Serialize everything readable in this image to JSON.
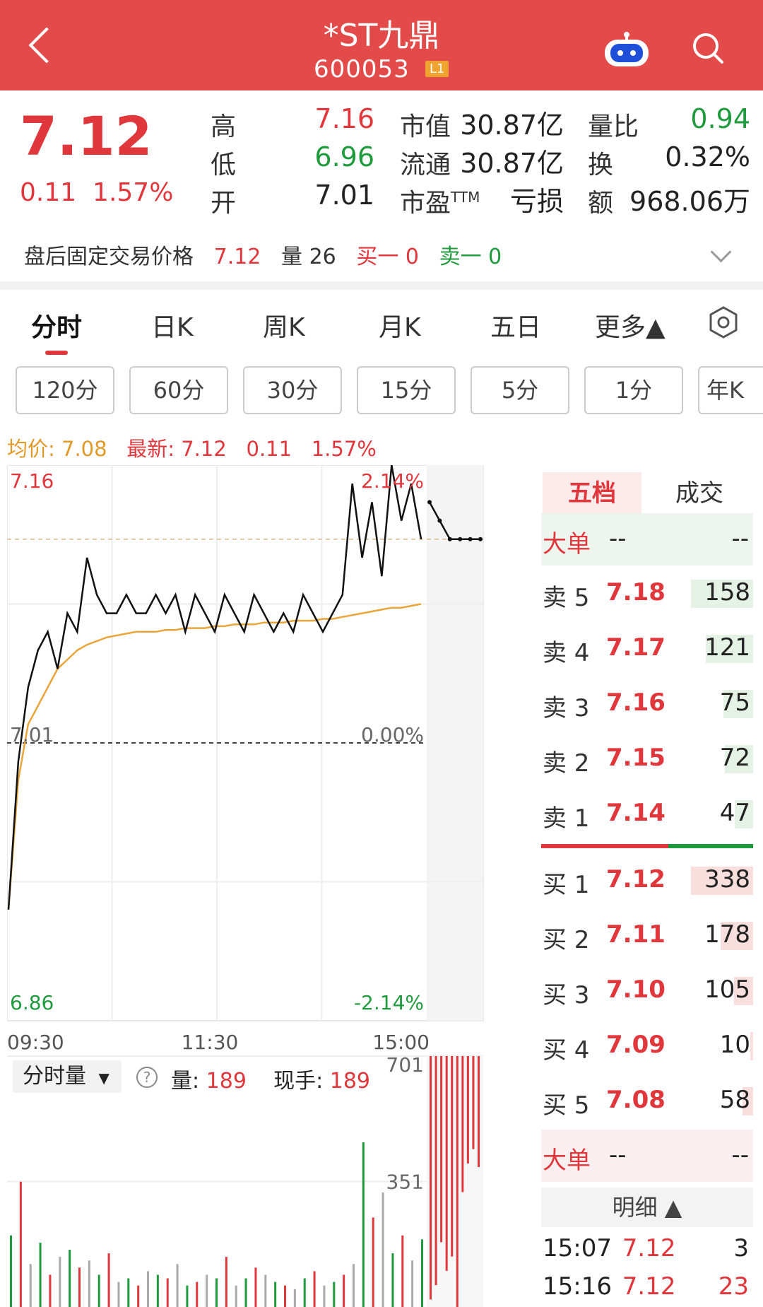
{
  "header": {
    "title": "*ST九鼎",
    "code": "600053",
    "level_badge": "L1",
    "bg_color": "#e34b4b"
  },
  "quote": {
    "price": "7.12",
    "change": "0.11",
    "change_pct": "1.57%",
    "fields": [
      {
        "label": "高",
        "value": "7.16",
        "color": "red"
      },
      {
        "label": "低",
        "value": "6.96",
        "color": "green"
      },
      {
        "label": "开",
        "value": "7.01",
        "color": "black"
      }
    ],
    "fields2": [
      {
        "label": "市值",
        "value": "30.87亿"
      },
      {
        "label": "流通",
        "value": "30.87亿"
      },
      {
        "label": "市盈",
        "sup": "TTM",
        "value": "亏损"
      }
    ],
    "fields3": [
      {
        "label": "量比",
        "value": "0.94",
        "color": "green"
      },
      {
        "label": "换",
        "value": "0.32%",
        "color": "black"
      },
      {
        "label": "额",
        "value": "968.06万",
        "color": "black"
      }
    ]
  },
  "after_hours": {
    "label": "盘后固定交易价格",
    "price": "7.12",
    "vol_label": "量",
    "vol": "26",
    "buy1": "买一 0",
    "sell1": "卖一 0"
  },
  "tabs": [
    "分时",
    "日K",
    "周K",
    "月K",
    "五日",
    "更多▲"
  ],
  "periods": [
    "120分",
    "60分",
    "30分",
    "15分",
    "5分",
    "1分",
    "年K"
  ],
  "info": {
    "avg_label": "均价:",
    "avg": "7.08",
    "last_label": "最新:",
    "last": "7.12",
    "chg": "0.11",
    "pct": "1.57%"
  },
  "chart_labels": {
    "high_price": "7.16",
    "high_pct": "2.14%",
    "mid_price": "7.01",
    "mid_pct": "0.00%",
    "low_price": "6.86",
    "low_pct": "-2.14%",
    "time_start": "09:30",
    "time_mid": "11:30",
    "time_end": "15:00",
    "vol_max": "701",
    "vol_mid": "351"
  },
  "volume_header": {
    "selector": "分时量",
    "vol_label": "量:",
    "vol": "189",
    "hand_label": "现手:",
    "hand": "189"
  },
  "order_book": {
    "tab_active": "五档",
    "tab_other": "成交",
    "big_label": "大单",
    "big_left": "--",
    "big_right": "--",
    "asks": [
      {
        "label": "卖 5",
        "price": "7.18",
        "vol": "158"
      },
      {
        "label": "卖 4",
        "price": "7.17",
        "vol": "121"
      },
      {
        "label": "卖 3",
        "price": "7.16",
        "vol": "75"
      },
      {
        "label": "卖 2",
        "price": "7.15",
        "vol": "72"
      },
      {
        "label": "卖 1",
        "price": "7.14",
        "vol": "47"
      }
    ],
    "bids": [
      {
        "label": "买 1",
        "price": "7.12",
        "vol": "338"
      },
      {
        "label": "买 2",
        "price": "7.11",
        "vol": "178"
      },
      {
        "label": "买 3",
        "price": "7.10",
        "vol": "105"
      },
      {
        "label": "买 4",
        "price": "7.09",
        "vol": "10"
      },
      {
        "label": "买 5",
        "price": "7.08",
        "vol": "58"
      }
    ],
    "detail_label": "明细 ▲",
    "ticks": [
      {
        "time": "15:07",
        "price": "7.12",
        "vol": "3"
      },
      {
        "time": "15:16",
        "price": "7.12",
        "vol": "23"
      }
    ]
  },
  "chart_data": {
    "type": "line",
    "title": "",
    "xlabel": "",
    "ylabel": "",
    "ylim": [
      6.86,
      7.16
    ],
    "x_ticks": [
      "09:30",
      "11:30",
      "15:00"
    ],
    "reference_price": 7.01,
    "series": [
      {
        "values": [
          6.92,
          7.0,
          7.04,
          7.06,
          7.07,
          7.05,
          7.08,
          7.07,
          7.11,
          7.09,
          7.08,
          7.08,
          7.09,
          7.08,
          7.08,
          7.09,
          7.08,
          7.09,
          7.07,
          7.09,
          7.08,
          7.07,
          7.09,
          7.08,
          7.07,
          7.09,
          7.08,
          7.07,
          7.08,
          7.07,
          7.09,
          7.08,
          7.07,
          7.08,
          7.09,
          7.15,
          7.11,
          7.14,
          7.1,
          7.16,
          7.13,
          7.15,
          7.12
        ]
      },
      {
        "values": [
          6.92,
          6.99,
          7.02,
          7.03,
          7.04,
          7.05,
          7.055,
          7.06,
          7.063,
          7.065,
          7.067,
          7.068,
          7.069,
          7.07,
          7.07,
          7.07,
          7.071,
          7.071,
          7.072,
          7.072,
          7.072,
          7.073,
          7.073,
          7.074,
          7.074,
          7.074,
          7.075,
          7.075,
          7.075,
          7.076,
          7.076,
          7.076,
          7.077,
          7.077,
          7.078,
          7.079,
          7.08,
          7.081,
          7.082,
          7.083,
          7.083,
          7.084,
          7.085
        ]
      }
    ],
    "after_hours_series": [
      {
        "values": [
          7.14,
          7.13,
          7.12,
          7.12,
          7.12,
          7.12
        ]
      }
    ],
    "volume": {
      "ylim": [
        0,
        701
      ],
      "bars": [
        200,
        350,
        120,
        180,
        90,
        140,
        160,
        110,
        130,
        90,
        150,
        70,
        80,
        60,
        100,
        90,
        80,
        120,
        60,
        70,
        90,
        80,
        140,
        60,
        80,
        110,
        90,
        70,
        60,
        50,
        80,
        100,
        60,
        70,
        90,
        120,
        460,
        250,
        320,
        150,
        200,
        130,
        189
      ],
      "after_hours_bars": [
        680,
        640,
        520,
        600,
        560,
        701,
        380,
        300,
        260,
        310
      ]
    }
  }
}
